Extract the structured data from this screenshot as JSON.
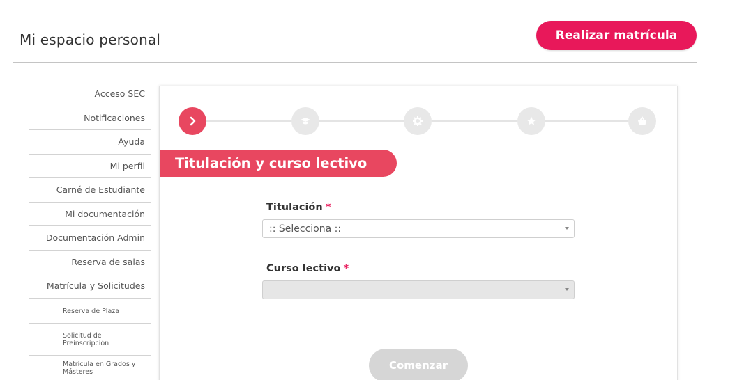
{
  "header": {
    "title": "Mi espacio personal",
    "enroll_button": "Realizar matrícula"
  },
  "sidebar": {
    "items": [
      {
        "label": "Acceso SEC"
      },
      {
        "label": "Notificaciones"
      },
      {
        "label": "Ayuda"
      },
      {
        "label": "Mi perfil"
      },
      {
        "label": "Carné de Estudiante"
      },
      {
        "label": "Mi documentación"
      },
      {
        "label": "Documentación Admin"
      },
      {
        "label": "Reserva de salas"
      },
      {
        "label": "Matrícula y Solicitudes"
      }
    ],
    "subitems": [
      {
        "label": "Reserva de Plaza"
      },
      {
        "label": "Solicitud de Preinscripción"
      },
      {
        "label": "Matrícula en Grados y Másteres"
      }
    ]
  },
  "stepper": {
    "current_step": 1,
    "total_steps": 5,
    "icons": [
      "chevron-right-icon",
      "graduation-cap-icon",
      "gear-icon",
      "star-icon",
      "basket-icon"
    ]
  },
  "section": {
    "title": "Titulación y curso lectivo"
  },
  "form": {
    "titulacion": {
      "label": "Titulación",
      "required_mark": "*",
      "value": ":: Selecciona ::"
    },
    "curso": {
      "label": "Curso lectivo",
      "required_mark": "*",
      "value": ""
    },
    "start_button": "Comenzar"
  },
  "colors": {
    "accent": "#e8185a",
    "section_accent": "#e84760",
    "step_inactive": "#e8e8e8",
    "button_disabled": "#d6d6d6"
  }
}
